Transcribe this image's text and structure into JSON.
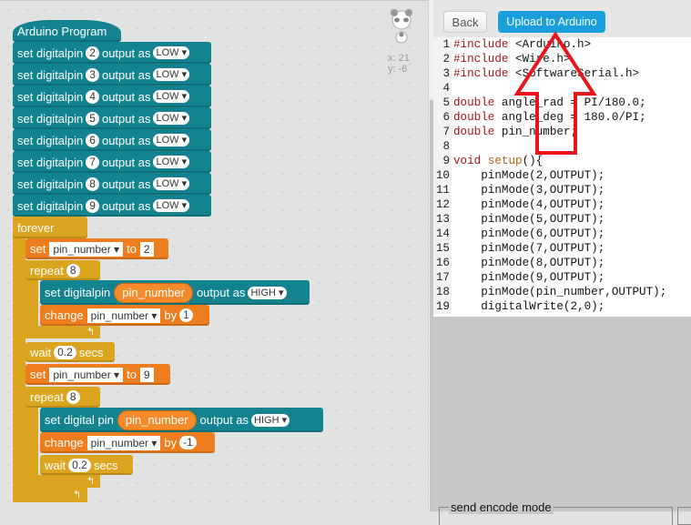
{
  "workspace": {
    "hat": "Arduino Program",
    "setup_blocks": [
      {
        "pre": "set digitalpin",
        "pin": "2",
        "mid": "output as",
        "val": "LOW"
      },
      {
        "pre": "set digitalpin",
        "pin": "3",
        "mid": "output as",
        "val": "LOW"
      },
      {
        "pre": "set digitalpin",
        "pin": "4",
        "mid": "output as",
        "val": "LOW"
      },
      {
        "pre": "set digitalpin",
        "pin": "5",
        "mid": "output as",
        "val": "LOW"
      },
      {
        "pre": "set digitalpin",
        "pin": "6",
        "mid": "output as",
        "val": "LOW"
      },
      {
        "pre": "set digitalpin",
        "pin": "7",
        "mid": "output as",
        "val": "LOW"
      },
      {
        "pre": "set digitalpin",
        "pin": "8",
        "mid": "output as",
        "val": "LOW"
      },
      {
        "pre": "set digitalpin",
        "pin": "9",
        "mid": "output as",
        "val": "LOW"
      }
    ],
    "forever": "forever",
    "set1": {
      "a": "set",
      "var": "pin_number",
      "b": "to",
      "val": "2"
    },
    "repeat1": {
      "label": "repeat",
      "n": "8"
    },
    "digital1": {
      "pre": "set digitalpin",
      "var": "pin_number",
      "mid": "output as",
      "val": "HIGH"
    },
    "change1": {
      "a": "change",
      "var": "pin_number",
      "b": "by",
      "val": "1"
    },
    "wait1": {
      "a": "wait",
      "val": "0.2",
      "b": "secs"
    },
    "set2": {
      "a": "set",
      "var": "pin_number",
      "b": "to",
      "val": "9"
    },
    "repeat2": {
      "label": "repeat",
      "n": "8"
    },
    "digital2": {
      "pre": "set digital pin",
      "var": "pin_number",
      "mid": "output as",
      "val": "HIGH"
    },
    "change2": {
      "a": "change",
      "var": "pin_number",
      "b": "by",
      "val": "-1"
    },
    "wait2": {
      "a": "wait",
      "val": "0.2",
      "b": "secs"
    },
    "coords": {
      "x": "x: 21",
      "y": "y: -6"
    }
  },
  "toolbar": {
    "back": "Back",
    "upload": "Upload to Arduino"
  },
  "code": [
    [
      [
        "#include",
        "kw"
      ],
      [
        " <Arduino.h>",
        ""
      ]
    ],
    [
      [
        "#include",
        "kw"
      ],
      [
        " <Wire.h>",
        ""
      ]
    ],
    [
      [
        "#include",
        "kw"
      ],
      [
        " <SoftwareSerial.h>",
        ""
      ]
    ],
    [],
    [
      [
        "double",
        "kw"
      ],
      [
        " angle_rad = PI/180.0;",
        ""
      ]
    ],
    [
      [
        "double",
        "kw"
      ],
      [
        " angle_deg = 180.0/PI;",
        ""
      ]
    ],
    [
      [
        "double",
        "kw"
      ],
      [
        " pin_number;",
        ""
      ]
    ],
    [],
    [
      [
        "void",
        "kw"
      ],
      [
        " ",
        ""
      ],
      [
        "setup",
        "fn"
      ],
      [
        "(){",
        ""
      ]
    ],
    [
      [
        "    pinMode(2,OUTPUT);",
        ""
      ]
    ],
    [
      [
        "    pinMode(3,OUTPUT);",
        ""
      ]
    ],
    [
      [
        "    pinMode(4,OUTPUT);",
        ""
      ]
    ],
    [
      [
        "    pinMode(5,OUTPUT);",
        ""
      ]
    ],
    [
      [
        "    pinMode(6,OUTPUT);",
        ""
      ]
    ],
    [
      [
        "    pinMode(7,OUTPUT);",
        ""
      ]
    ],
    [
      [
        "    pinMode(8,OUTPUT);",
        ""
      ]
    ],
    [
      [
        "    pinMode(9,OUTPUT);",
        ""
      ]
    ],
    [
      [
        "    pinMode(pin_number,OUTPUT);",
        ""
      ]
    ],
    [
      [
        "    digitalWrite(2,0);",
        ""
      ]
    ]
  ],
  "bottom": {
    "fieldset1": "send encode mode"
  },
  "colors": {
    "teal": "#12838f",
    "orange": "#ef7d1d",
    "gold": "#dba520",
    "upload": "#1a9fdb",
    "arrow": "#e8141c"
  }
}
